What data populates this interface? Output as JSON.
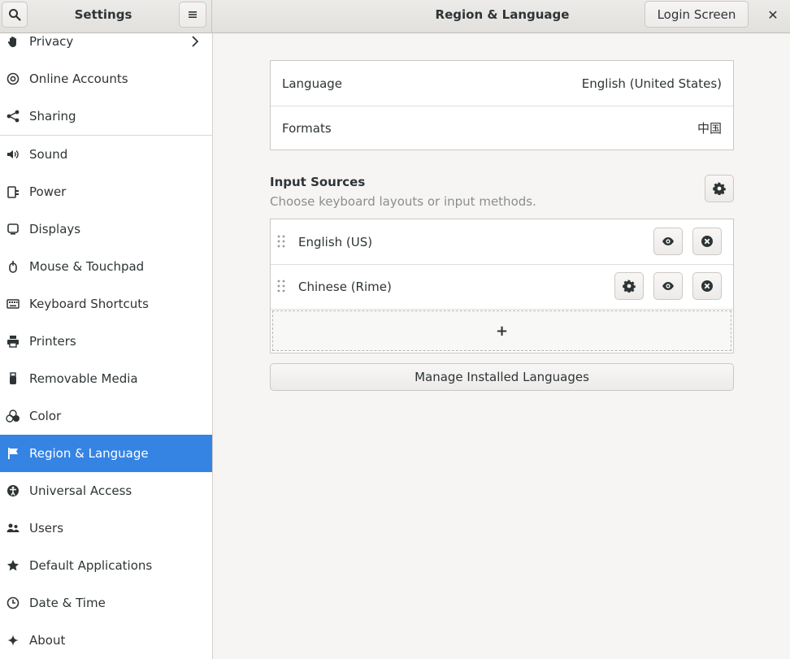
{
  "header": {
    "left_title": "Settings",
    "right_title": "Region & Language",
    "login_button": "Login Screen",
    "close_glyph": "✕"
  },
  "sidebar": {
    "items": [
      {
        "label": "Privacy",
        "icon": "hand-icon"
      },
      {
        "label": "Online Accounts",
        "icon": "at-icon"
      },
      {
        "label": "Sharing",
        "icon": "share-icon"
      },
      {
        "label": "Sound",
        "icon": "speaker-icon"
      },
      {
        "label": "Power",
        "icon": "power-icon"
      },
      {
        "label": "Displays",
        "icon": "display-icon"
      },
      {
        "label": "Mouse & Touchpad",
        "icon": "mouse-icon"
      },
      {
        "label": "Keyboard Shortcuts",
        "icon": "keyboard-icon"
      },
      {
        "label": "Printers",
        "icon": "printer-icon"
      },
      {
        "label": "Removable Media",
        "icon": "usb-icon"
      },
      {
        "label": "Color",
        "icon": "color-icon"
      },
      {
        "label": "Region & Language",
        "icon": "flag-icon",
        "active": true
      },
      {
        "label": "Universal Access",
        "icon": "accessibility-icon"
      },
      {
        "label": "Users",
        "icon": "users-icon"
      },
      {
        "label": "Default Applications",
        "icon": "star-icon"
      },
      {
        "label": "Date & Time",
        "icon": "clock-icon"
      },
      {
        "label": "About",
        "icon": "sparkle-icon"
      }
    ]
  },
  "region": {
    "language_key": "Language",
    "language_value": "English (United States)",
    "formats_key": "Formats",
    "formats_value": "中国"
  },
  "input_sources": {
    "heading": "Input Sources",
    "subtitle": "Choose keyboard layouts or input methods.",
    "sources": [
      {
        "label": "English (US)"
      },
      {
        "label": "Chinese (Rime)"
      }
    ],
    "add_glyph": "+"
  },
  "manage_button": "Manage Installed Languages",
  "colors": {
    "accent": "#3584e4",
    "sidebar_bg": "#ffffff",
    "content_bg": "#f6f5f4"
  }
}
